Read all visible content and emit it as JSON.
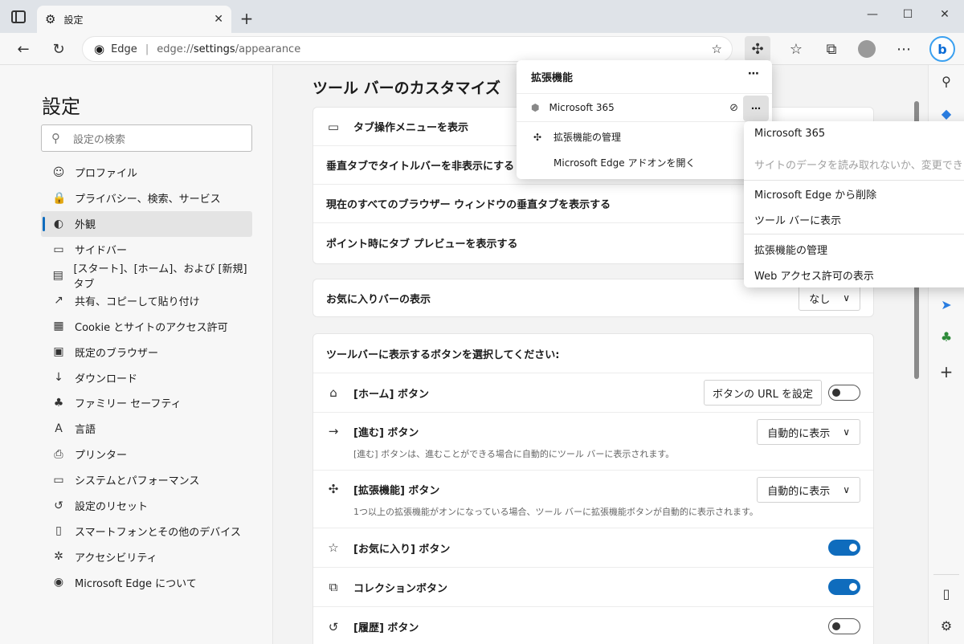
{
  "browser": {
    "tab_title": "設定",
    "address": {
      "brand": "Edge",
      "url_prefix": "edge://",
      "url_host": "settings",
      "url_path": "/appearance"
    }
  },
  "left_nav": {
    "title": "設定",
    "search_placeholder": "設定の検索",
    "items": [
      {
        "label": "プロファイル",
        "icon": "profile-icon",
        "glyph": "☺"
      },
      {
        "label": "プライバシー、検索、サービス",
        "icon": "lock-icon",
        "glyph": "🔒"
      },
      {
        "label": "外観",
        "icon": "palette-icon",
        "glyph": "◐",
        "selected": true
      },
      {
        "label": "サイドバー",
        "icon": "sidebar-icon",
        "glyph": "▭"
      },
      {
        "label": "[スタート]、[ホーム]、および [新規] タブ",
        "icon": "home-tabs-icon",
        "glyph": "▤"
      },
      {
        "label": "共有、コピーして貼り付け",
        "icon": "share-icon",
        "glyph": "↗"
      },
      {
        "label": "Cookie とサイトのアクセス許可",
        "icon": "cookie-icon",
        "glyph": "▦"
      },
      {
        "label": "既定のブラウザー",
        "icon": "browser-icon",
        "glyph": "▣"
      },
      {
        "label": "ダウンロード",
        "icon": "download-icon",
        "glyph": "↓"
      },
      {
        "label": "ファミリー セーフティ",
        "icon": "family-icon",
        "glyph": "♣"
      },
      {
        "label": "言語",
        "icon": "language-icon",
        "glyph": "A"
      },
      {
        "label": "プリンター",
        "icon": "printer-icon",
        "glyph": "⎙"
      },
      {
        "label": "システムとパフォーマンス",
        "icon": "laptop-icon",
        "glyph": "▭"
      },
      {
        "label": "設定のリセット",
        "icon": "reset-icon",
        "glyph": "↺"
      },
      {
        "label": "スマートフォンとその他のデバイス",
        "icon": "phone-icon",
        "glyph": "▯"
      },
      {
        "label": "アクセシビリティ",
        "icon": "accessibility-icon",
        "glyph": "✲"
      },
      {
        "label": "Microsoft Edge について",
        "icon": "edge-icon",
        "glyph": "◉"
      }
    ]
  },
  "main": {
    "section_title": "ツール バーのカスタマイズ",
    "card1": [
      {
        "label": "タブ操作メニューを表示",
        "icon": "tab-menu-icon"
      },
      {
        "label": "垂直タブでタイトルバーを非表示にする"
      },
      {
        "label": "現在のすべてのブラウザー ウィンドウの垂直タブを表示する"
      },
      {
        "label": "ポイント時にタブ プレビューを表示する"
      }
    ],
    "favorites_bar": {
      "label": "お気に入りバーの表示",
      "value": "なし"
    },
    "buttons_header": "ツールバーに表示するボタンを選択してください:",
    "home_button": {
      "label": "[ホーム] ボタン",
      "set_url": "ボタンの URL を設定",
      "toggle": false
    },
    "forward_button": {
      "label": "[進む] ボタン",
      "value": "自動的に表示",
      "desc": "[進む] ボタンは、進むことができる場合に自動的にツール バーに表示されます。"
    },
    "extensions_button": {
      "label": "[拡張機能] ボタン",
      "value": "自動的に表示",
      "desc": "1つ以上の拡張機能がオンになっている場合、ツール バーに拡張機能ボタンが自動的に表示されます。"
    },
    "favorites_button": {
      "label": "[お気に入り] ボタン",
      "toggle": true
    },
    "collections_button": {
      "label": "コレクションボタン",
      "toggle": true
    },
    "history_button": {
      "label": "[履歴] ボタン",
      "toggle": false
    }
  },
  "extensions_flyout": {
    "title": "拡張機能",
    "extension_name": "Microsoft 365",
    "manage": "拡張機能の管理",
    "open_addons": "Microsoft Edge アドオンを開く"
  },
  "context_menu": {
    "title": "Microsoft 365",
    "disabled_text": "サイトのデータを読み取れないか、変更できません",
    "remove": "Microsoft Edge から削除",
    "show_toolbar": "ツール バーに表示",
    "manage": "拡張機能の管理",
    "web_access": "Web アクセス許可の表示"
  },
  "colors": {
    "accent": "#0f6cbd",
    "titlebar": "#dfe3e8"
  }
}
